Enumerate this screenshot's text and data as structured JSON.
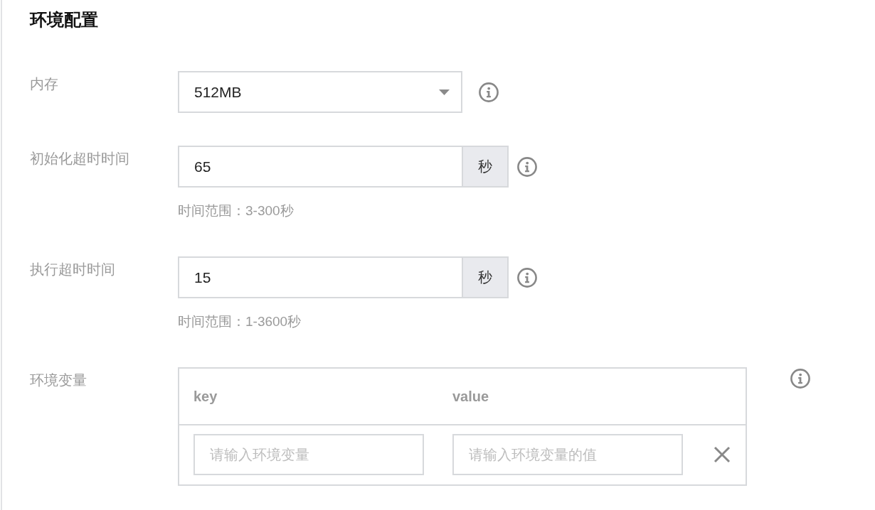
{
  "section": {
    "title": "环境配置"
  },
  "fields": [
    {
      "kind": "select",
      "label": "内存",
      "value": "512MB"
    },
    {
      "kind": "number",
      "label": "初始化超时时间",
      "value": "65",
      "unit": "秒",
      "hint": "时间范围：3-300秒"
    },
    {
      "kind": "number",
      "label": "执行超时时间",
      "value": "15",
      "unit": "秒",
      "hint": "时间范围：1-3600秒"
    },
    {
      "kind": "env_table",
      "label": "环境变量",
      "table": {
        "columns": [
          "key",
          "value"
        ],
        "rows": [
          {
            "key": {
              "placeholder": "请输入环境变量"
            },
            "value": {
              "placeholder": "请输入环境变量的值"
            }
          }
        ]
      }
    }
  ]
}
